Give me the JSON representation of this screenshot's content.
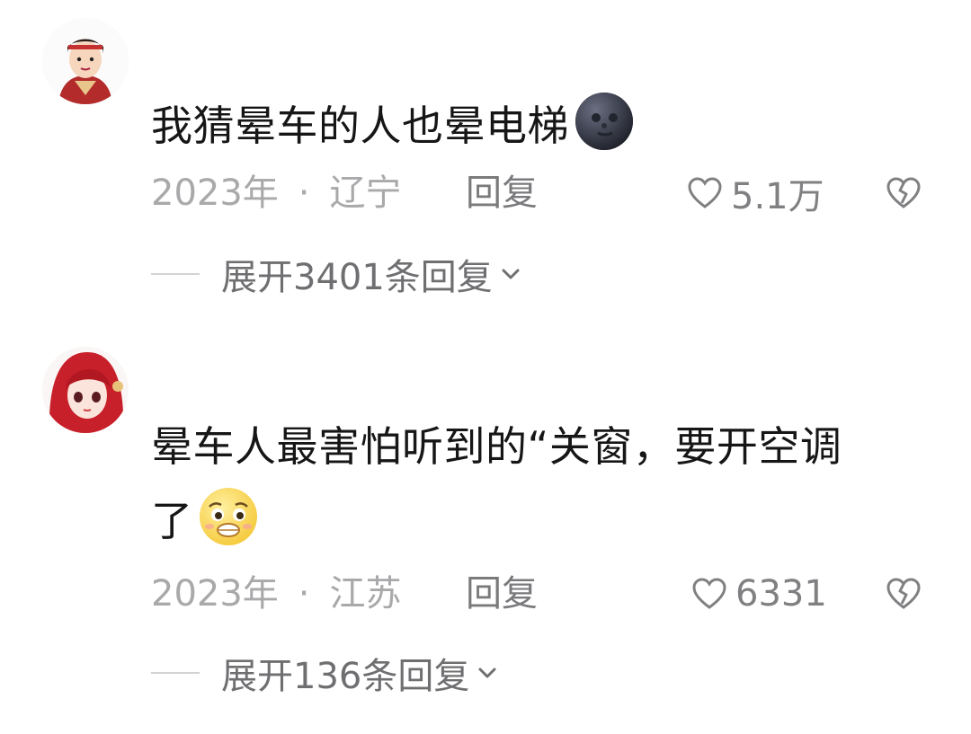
{
  "comments": [
    {
      "text": "我猜晕车的人也晕电梯",
      "emoji": "new-moon-face-emoji",
      "year": "2023年",
      "separator": "·",
      "location": "辽宁",
      "reply_label": "回复",
      "likes": "5.1万",
      "expand_label": "展开3401条回复"
    },
    {
      "text_line1": "晕车人最害怕听到的“关窗，要开空调",
      "text_line2": "了",
      "emoji": "pleading-nauseated-emoji",
      "year": "2023年",
      "separator": "·",
      "location": "江苏",
      "reply_label": "回复",
      "likes": "6331",
      "expand_label": "展开136条回复"
    }
  ],
  "colors": {
    "meta_text": "#a9a9ab",
    "action_text": "#808083",
    "body_text": "#161616"
  }
}
